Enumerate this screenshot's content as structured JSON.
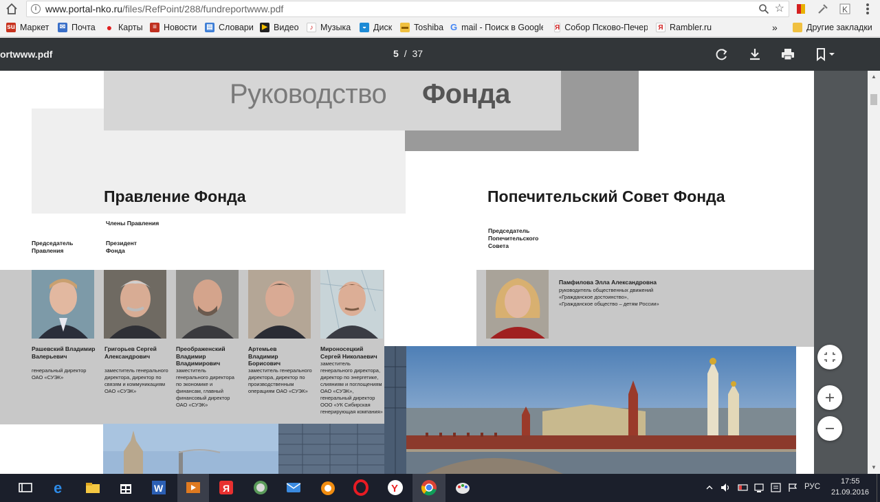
{
  "browser": {
    "url_host": "www.portal-nko.ru",
    "url_path": "/files/RefPoint/288/fundreportwww.pdf",
    "bookmarks": [
      "Маркет",
      "Почта",
      "Карты",
      "Новости",
      "Словари",
      "Видео",
      "Музыка",
      "Диск",
      "Toshiba",
      "mail - Поиск в Google",
      "Собор Псково-Печер",
      "Rambler.ru"
    ],
    "overflow": "»",
    "other_bookmarks": "Другие закладки"
  },
  "pdf": {
    "title": "ortwww.pdf",
    "page_current": "5",
    "page_separator": "/",
    "page_total": "37"
  },
  "document": {
    "heading_light": "Руководство",
    "heading_bold": "Фонда",
    "board_title": "Правление Фонда",
    "trustees_title": "Попечительский Совет Фонда",
    "board_members_label": "Члены Правления",
    "chairman_label": "Председатель Правления",
    "president_label": "Президент Фонда",
    "trustees_chair_label": "Председатель Попечительского Совета",
    "people": [
      {
        "name": "Рашевский Владимир Валерьевич",
        "role": "генеральный директор ОАО «СУЭК»"
      },
      {
        "name": "Григорьев Сергей Александрович",
        "role": "заместитель генерального директора, директор по связям и коммуникациям ОАО «СУЭК»"
      },
      {
        "name": "Преображенский Владимир Владимирович",
        "role": "заместитель генерального директора по экономике и финансам, главный финансовый директор ОАО «СУЭК»"
      },
      {
        "name": "Артемьев Владимир Борисович",
        "role": "заместитель генерального директора, директор по производственным операциям ОАО «СУЭК»"
      },
      {
        "name": "Мироносецкий Сергей Николаевич",
        "role": "заместитель генерального директора, директор по энергетике, слияниям и поглощениям ОАО «СУЭК», генеральный директор ООО «УК Сибирская генерирующая компания»"
      }
    ],
    "trustee": {
      "name": "Памфилова Элла Александровна",
      "role": "руководитель общественных движений «Гражданское достоинство», «Гражданское общество – детям России»"
    }
  },
  "taskbar": {
    "lang": "РУС",
    "time": "17:55",
    "date": "21.09.2016"
  }
}
